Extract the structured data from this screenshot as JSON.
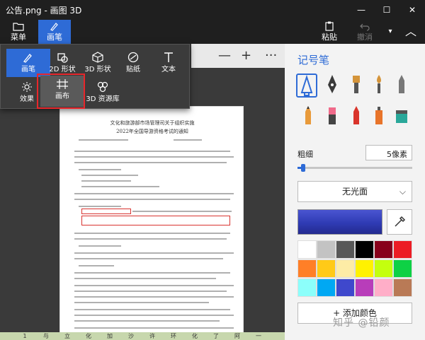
{
  "window": {
    "title": "公告.png - 画图 3D"
  },
  "toolbar": {
    "menu_label": "菜单",
    "brush_label": "画笔",
    "paste_label": "粘贴",
    "undo_label": "撤消"
  },
  "popup": {
    "items": [
      {
        "label": "画笔",
        "icon": "brush-icon"
      },
      {
        "label": "2D 形状",
        "icon": "2d-shape-icon"
      },
      {
        "label": "3D 形状",
        "icon": "3d-shape-icon"
      },
      {
        "label": "贴纸",
        "icon": "sticker-icon"
      },
      {
        "label": "文本",
        "icon": "text-icon"
      },
      {
        "label": "效果",
        "icon": "effects-icon"
      },
      {
        "label": "画布",
        "icon": "canvas-icon"
      },
      {
        "label": "3D 资源库",
        "icon": "3d-library-icon"
      }
    ]
  },
  "canvas_toolbar": {
    "minus": "—",
    "plus": "+",
    "more": "···"
  },
  "document": {
    "title_line1": "文化和旅游部市场管理司关于组织实施",
    "title_line2": "2022年全国导游资格考试的通知"
  },
  "bottom_strip": [
    "1",
    "与",
    "立",
    "化",
    "加",
    "沙",
    "许",
    "环",
    "化",
    "了",
    "阿",
    "一"
  ],
  "panel": {
    "title": "记号笔",
    "thickness_label": "粗细",
    "thickness_value": "5像素",
    "thickness_fraction": 0.05,
    "finish_option": "无光面",
    "add_color_label": "+ 添加颜色",
    "current_color": "#2f3bb4",
    "swatches": [
      "#ffffff",
      "#c3c3c3",
      "#585858",
      "#000000",
      "#88001b",
      "#ec1c24",
      "#ff7f27",
      "#ffca18",
      "#fdeca6",
      "#fff200",
      "#c4ff0e",
      "#0ed145",
      "#8cfffb",
      "#00a8f3",
      "#3f48cc",
      "#b83dba",
      "#ffaec8",
      "#b97a56"
    ]
  },
  "watermark": "知乎 @铅颜"
}
